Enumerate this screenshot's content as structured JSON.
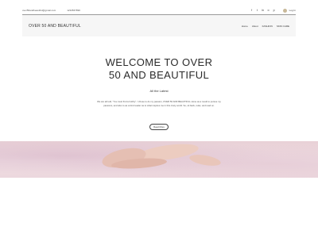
{
  "topbar": {
    "email": "over50andbeautiful@gmail.com",
    "phone": "1234567890",
    "social": [
      {
        "name": "facebook-icon",
        "glyph": "f"
      },
      {
        "name": "twitter-icon",
        "glyph": "t"
      },
      {
        "name": "linkedin-icon",
        "glyph": "in"
      },
      {
        "name": "link-icon",
        "glyph": "∞"
      },
      {
        "name": "pinterest-icon",
        "glyph": "p"
      }
    ],
    "login_label": "Log In"
  },
  "header": {
    "site_title": "OVER 50 AND BEAUTIFUL",
    "menu": [
      "Home",
      "About",
      "FASHION",
      "SKIN CARE"
    ]
  },
  "hero": {
    "title_line1": "WELCOME TO OVER",
    "title_line2": "50 AND BEAUTIFUL",
    "subtitle": "All the Latest",
    "body": "We are all told, \"You must find a hobby\". I chose to do my passion, OVER 50 AND BEAUTIFUL came as a result to pursue my passions, and also to as a kind reader as to what inspires me in this crazy world. So, sit back, relax, and read on.",
    "read_more_label": "Read More"
  },
  "colors": {
    "accent_gold": "#c9b99a",
    "photo_pink": "#e8d0d6"
  }
}
